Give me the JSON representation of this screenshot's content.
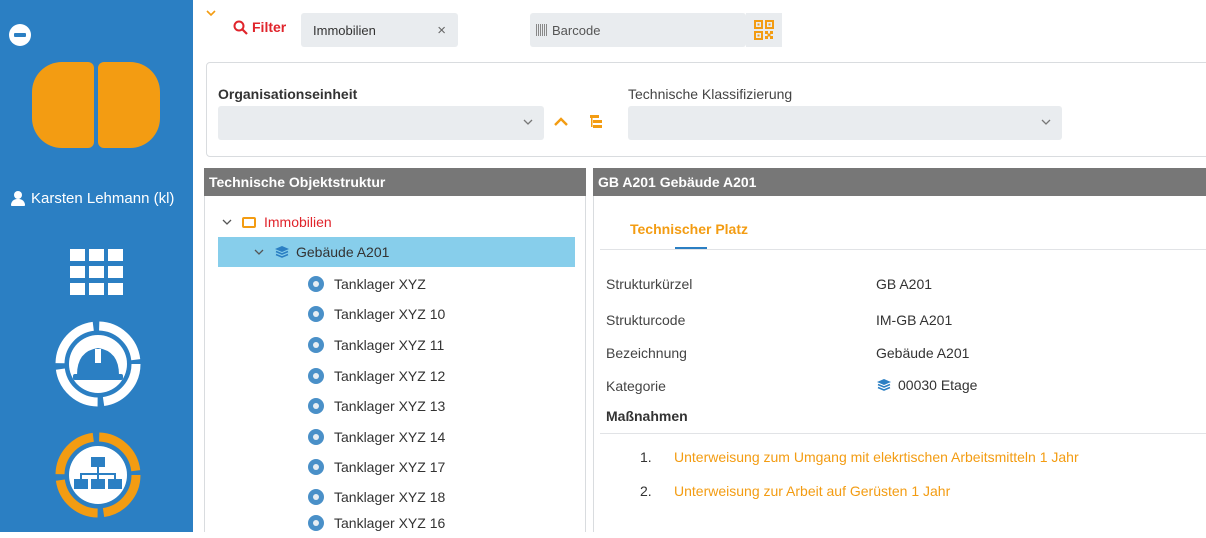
{
  "sidebar": {
    "user_name": "Karsten Lehmann (kl)",
    "colors": {
      "background": "#2b7fc3",
      "accent": "#f39c12"
    },
    "icons": [
      "collapse-icon",
      "app-logo",
      "user-icon",
      "apps-grid-icon",
      "helmet-icon",
      "org-chart-icon"
    ]
  },
  "filterbar": {
    "filter_label": "Filter",
    "chip_label": "Immobilien",
    "chip_close": "×",
    "barcode_placeholder": "Barcode"
  },
  "filterpanel": {
    "org_label": "Organisationseinheit",
    "org_value": "",
    "tech_label": "Technische Klassifizierung",
    "tech_value": ""
  },
  "tree": {
    "title": "Technische Objektstruktur",
    "root": "Immobilien",
    "selected": "Gebäude A201",
    "children": [
      "Tanklager XYZ",
      "Tanklager XYZ 10",
      "Tanklager XYZ 11",
      "Tanklager XYZ 12",
      "Tanklager XYZ 13",
      "Tanklager XYZ 14",
      "Tanklager XYZ 17",
      "Tanklager XYZ 18",
      "Tanklager XYZ 16"
    ]
  },
  "details": {
    "title": "GB A201 Gebäude A201",
    "tab": "Technischer Platz",
    "fields": [
      {
        "label": "Strukturkürzel",
        "value": "GB A201"
      },
      {
        "label": "Strukturcode",
        "value": "IM-GB A201"
      },
      {
        "label": "Bezeichnung",
        "value": "Gebäude A201"
      },
      {
        "label": "Kategorie",
        "value": "00030 Etage"
      }
    ],
    "measures_title": "Maßnahmen",
    "measures": [
      {
        "num": "1.",
        "text": "Unterweisung zum Umgang mit elekrtischen Arbeitsmitteln 1 Jahr"
      },
      {
        "num": "2.",
        "text": "Unterweisung zur Arbeit auf Gerüsten 1 Jahr"
      }
    ]
  }
}
